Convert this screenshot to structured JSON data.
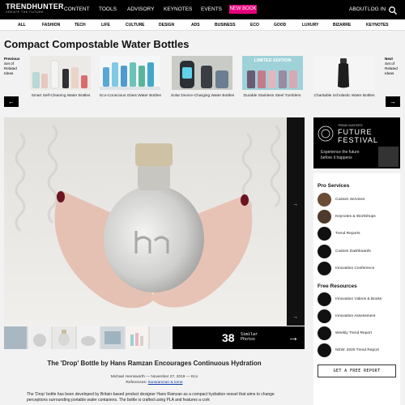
{
  "brand": {
    "name": "TRENDHUNTER",
    "tagline": "CREATE THE FUTURE"
  },
  "nav": {
    "items": [
      "CONTENT",
      "TOOLS",
      "ADVISORY",
      "KEYNOTES",
      "EVENTS"
    ],
    "new_book": "NEW BOOK",
    "about": "ABOUT",
    "login": "LOG IN"
  },
  "categories": [
    "ALL",
    "FASHION",
    "TECH",
    "LIFE",
    "CULTURE",
    "DESIGN",
    "ADS",
    "BUSINESS",
    "ECO",
    "GOOD",
    "LUXURY",
    "BIZARRE",
    "KEYNOTES"
  ],
  "page_title": "Compact Compostable Water Bottles",
  "related": {
    "prev_label": [
      "Previous",
      "Set of",
      "Related",
      "Ideas"
    ],
    "next_label": [
      "Next",
      "Set of",
      "Related",
      "Ideas"
    ],
    "items": [
      {
        "caption": "Smart Self-Cleaning Water Bottles"
      },
      {
        "caption": "Eco-Conscious Glass Water Bottles"
      },
      {
        "caption": "Solar Device-Charging Water Bottles"
      },
      {
        "caption": "Durable Stainless Steel Tumblers",
        "badge": "LIMITED EDITION"
      },
      {
        "caption": "Charitable Scholastic Water Bottles"
      }
    ]
  },
  "gallery": {
    "similar_count": "38",
    "similar_label": [
      "Similar",
      "Photos"
    ]
  },
  "article": {
    "title": "The 'Drop' Bottle by Hans Ramzan Encourages Continuous Hydration",
    "byline": "Michael Hemsworth — November 27, 2019 — Eco",
    "references_label": "References:",
    "references": "hansramzan & tome",
    "body": "The 'Drop' bottle has been developed by Britain-based product designer Hans Ramzan as a compact hydration vessel that aims to change perceptions surrounding portable water containers. The bottle is crafted using PLA and features a cork"
  },
  "ad": {
    "small": "TREND HUNTER'S",
    "headline": [
      "FUTURE",
      "FESTIVAL"
    ],
    "sub": [
      "Experience the future",
      "before it happens"
    ]
  },
  "pro_services": {
    "heading": "Pro Services",
    "items": [
      "Custom Services",
      "Keynotes & Workshops",
      "Trend Reports",
      "Custom Dashboards",
      "Innovation Conference"
    ]
  },
  "free_resources": {
    "heading": "Free Resources",
    "items": [
      "Innovation Videos & Books",
      "Innovation Assessment",
      "Weekly Trend Report",
      "NEW: 2020 Trend Report"
    ]
  },
  "report_button": "GET A FREE REPORT",
  "colors": {
    "accent": "#e4007c",
    "bar": "#000000",
    "link": "#0a3fa8"
  }
}
